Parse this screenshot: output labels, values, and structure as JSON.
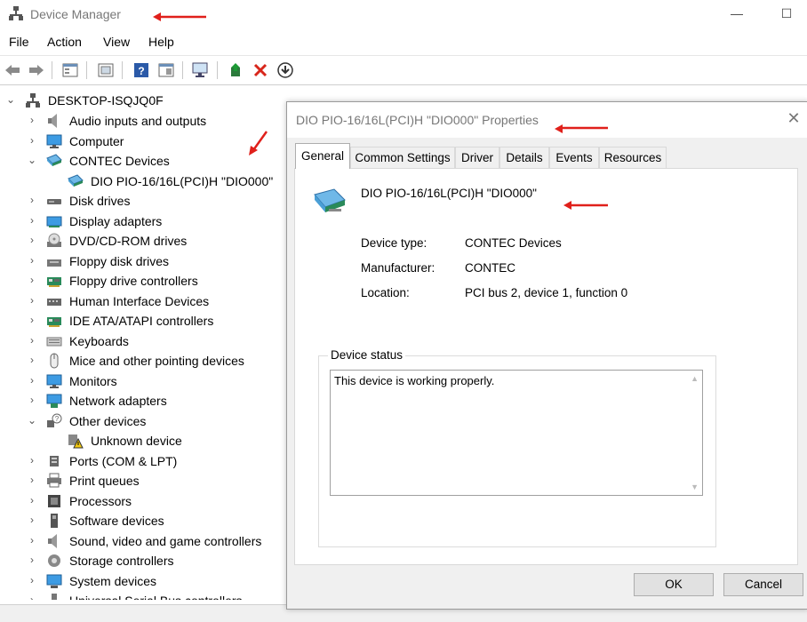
{
  "window": {
    "title": "Device Manager",
    "minimize": "—",
    "maximize": "☐"
  },
  "menu": [
    "File",
    "Action",
    "View",
    "Help"
  ],
  "tree": {
    "root": "DESKTOP-ISQJQ0F",
    "items": [
      {
        "label": "Audio inputs and outputs",
        "expanded": false,
        "icon": "speaker-icon"
      },
      {
        "label": "Computer",
        "expanded": false,
        "icon": "monitor-icon"
      },
      {
        "label": "CONTEC Devices",
        "expanded": true,
        "icon": "contec-card-icon"
      },
      {
        "label": "DIO PIO-16/16L(PCI)H \"DIO000\"",
        "child": true,
        "icon": "contec-card-icon"
      },
      {
        "label": "Disk drives",
        "expanded": false,
        "icon": "disk-icon"
      },
      {
        "label": "Display adapters",
        "expanded": false,
        "icon": "display-adapter-icon"
      },
      {
        "label": "DVD/CD-ROM drives",
        "expanded": false,
        "icon": "dvd-icon"
      },
      {
        "label": "Floppy disk drives",
        "expanded": false,
        "icon": "floppy-icon"
      },
      {
        "label": "Floppy drive controllers",
        "expanded": false,
        "icon": "controller-icon"
      },
      {
        "label": "Human Interface Devices",
        "expanded": false,
        "icon": "hid-icon"
      },
      {
        "label": "IDE ATA/ATAPI controllers",
        "expanded": false,
        "icon": "controller-icon"
      },
      {
        "label": "Keyboards",
        "expanded": false,
        "icon": "keyboard-icon"
      },
      {
        "label": "Mice and other pointing devices",
        "expanded": false,
        "icon": "mouse-icon"
      },
      {
        "label": "Monitors",
        "expanded": false,
        "icon": "monitor-icon"
      },
      {
        "label": "Network adapters",
        "expanded": false,
        "icon": "network-icon"
      },
      {
        "label": "Other devices",
        "expanded": true,
        "icon": "unknown-device-icon"
      },
      {
        "label": "Unknown device",
        "child": true,
        "icon": "warning-device-icon"
      },
      {
        "label": "Ports (COM & LPT)",
        "expanded": false,
        "icon": "port-icon"
      },
      {
        "label": "Print queues",
        "expanded": false,
        "icon": "printer-icon"
      },
      {
        "label": "Processors",
        "expanded": false,
        "icon": "cpu-icon"
      },
      {
        "label": "Software devices",
        "expanded": false,
        "icon": "software-device-icon"
      },
      {
        "label": "Sound, video and game controllers",
        "expanded": false,
        "icon": "speaker-icon"
      },
      {
        "label": "Storage controllers",
        "expanded": false,
        "icon": "storage-icon"
      },
      {
        "label": "System devices",
        "expanded": false,
        "icon": "system-icon"
      },
      {
        "label": "Universal Serial Bus controllers",
        "expanded": false,
        "icon": "usb-icon"
      }
    ]
  },
  "dialog": {
    "title": "DIO PIO-16/16L(PCI)H \"DIO000\" Properties",
    "tabs": [
      "General",
      "Common Settings",
      "Driver",
      "Details",
      "Events",
      "Resources"
    ],
    "device_name": "DIO PIO-16/16L(PCI)H \"DIO000\"",
    "fields": [
      {
        "label": "Device type:",
        "value": "CONTEC Devices"
      },
      {
        "label": "Manufacturer:",
        "value": "CONTEC"
      },
      {
        "label": "Location:",
        "value": "PCI bus 2, device 1, function 0"
      }
    ],
    "status_legend": "Device status",
    "status_text": "This device is working properly.",
    "ok_label": "OK",
    "cancel_label": "Cancel"
  },
  "colors": {
    "annotation_arrow": "#e0201b",
    "accent": "#0078d7"
  }
}
